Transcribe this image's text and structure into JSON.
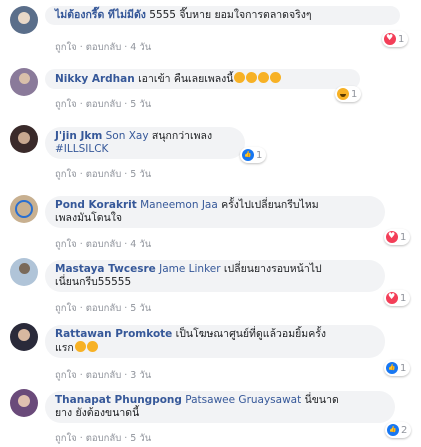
{
  "actions": {
    "like": "ถูกใจ",
    "reply": "ตอบกลับ",
    "sep": "·"
  },
  "colors": {
    "name": "#365899",
    "bubble": "#f2f3f5",
    "meta": "#90949c",
    "heart": "#f33e58",
    "like": "#1877f2",
    "haha": "#f7b125"
  },
  "comments": [
    {
      "name": "ไม่ต้องกรี๊ด ทีไม่มีดัง",
      "text": "5555 จี๊บหาย ยอมใจการตลาดจริงๆ",
      "time": "4 วัน",
      "react_count": "1",
      "react_icons": [
        "heart-icon"
      ]
    },
    {
      "name": "Nikky Ardhan",
      "text": "เอาเข้า คืนเลยเพลงนี้",
      "time": "5 วัน",
      "react_count": "1",
      "react_icons": [
        "haha-icon"
      ]
    },
    {
      "name": "J'jin Jkm",
      "tag": "Son Xay",
      "text": "สนุกกว่าเพลง",
      "text2": "#ILLSILCK",
      "time": "5 วัน",
      "react_count": "1",
      "react_icons": [
        "like-icon"
      ]
    },
    {
      "name": "Pond Korakrit",
      "tag": "Maneemon Jaa",
      "text": "ครั้งไปเปลี่ยนกรีบไหม",
      "text2": "เพลงมันโดนใจ",
      "time": "4 วัน",
      "react_count": "1",
      "react_icons": [
        "heart-icon"
      ]
    },
    {
      "name": "Mastaya Twcesre",
      "tag": "Jame Linker",
      "text": "เปลี่ยนยางรอบหน้าไป",
      "text2": "เนี่ยนกรีบ55555",
      "time": "5 วัน",
      "react_count": "1",
      "react_icons": [
        "heart-icon"
      ]
    },
    {
      "name": "Rattawan Promkote",
      "text": "เป็นโฆษณาศูนย์ที่ดูแล้วอมยิ้มครั้ง",
      "text2": "แรก",
      "time": "3 วัน",
      "react_count": "1",
      "react_icons": [
        "like-icon"
      ]
    },
    {
      "name": "Thanapat Phungpong",
      "tag": "Patsawee Gruaysawat",
      "text": "นี่ขนาด",
      "text2": "ยาง ยังต้องขนาดนี้",
      "time": "5 วัน",
      "react_count": "2",
      "react_icons": [
        "like-icon"
      ]
    }
  ]
}
